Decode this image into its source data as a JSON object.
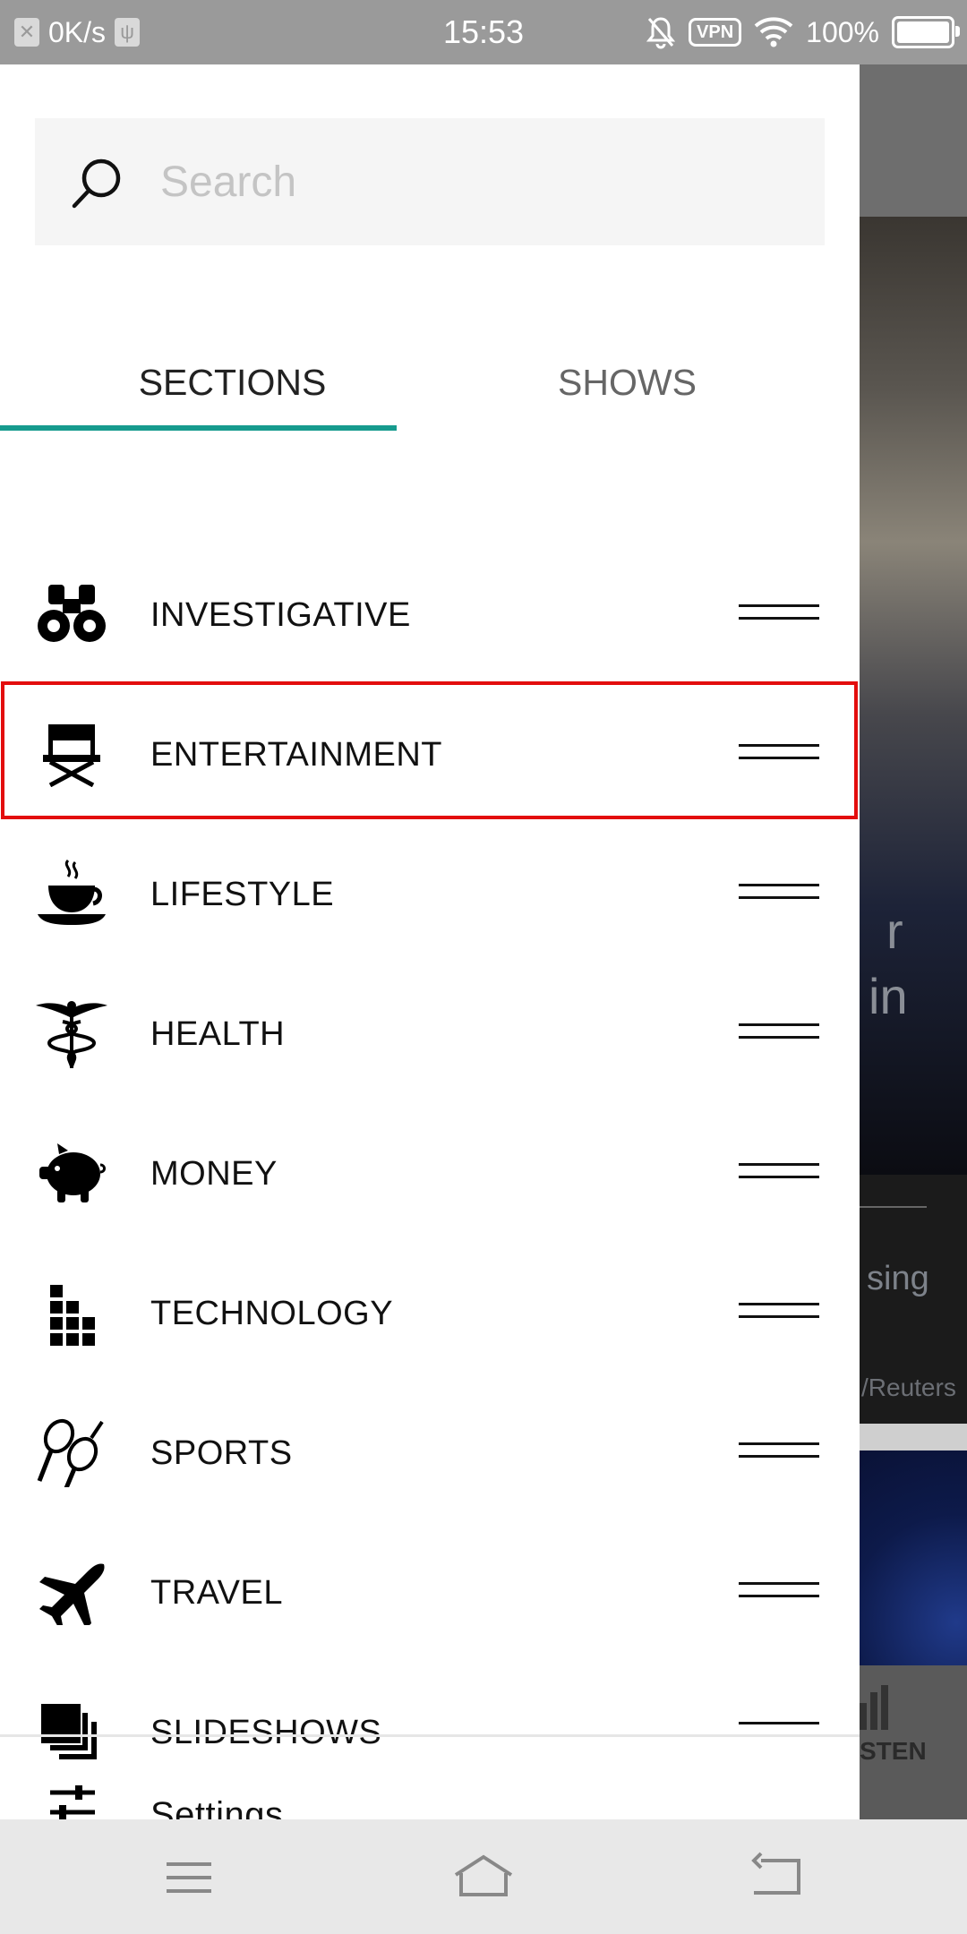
{
  "status_bar": {
    "speed": "0K/s",
    "time": "15:53",
    "vpn": "VPN",
    "battery_text": "100%",
    "battery_level": 1.0
  },
  "search": {
    "placeholder": "Search",
    "value": ""
  },
  "tabs": [
    {
      "label": "SECTIONS",
      "selected": true
    },
    {
      "label": "SHOWS",
      "selected": false
    }
  ],
  "accent_color": "#169b8e",
  "highlight_color": "#e30d0d",
  "sections": [
    {
      "label": "INVESTIGATIVE",
      "icon": "binoculars-icon"
    },
    {
      "label": "ENTERTAINMENT",
      "icon": "director-chair-icon",
      "highlighted": true
    },
    {
      "label": "LIFESTYLE",
      "icon": "coffee-cup-icon"
    },
    {
      "label": "HEALTH",
      "icon": "caduceus-icon"
    },
    {
      "label": "MONEY",
      "icon": "piggy-bank-icon"
    },
    {
      "label": "TECHNOLOGY",
      "icon": "blocks-icon"
    },
    {
      "label": "SPORTS",
      "icon": "tennis-rackets-icon"
    },
    {
      "label": "TRAVEL",
      "icon": "airplane-icon"
    },
    {
      "label": "SLIDESHOWS",
      "icon": "stacked-squares-icon"
    }
  ],
  "settings": {
    "label": "Settings",
    "icon": "sliders-icon"
  },
  "background": {
    "snippet_1": "r",
    "snippet_2": "in",
    "snippet_3": "sing",
    "snippet_4": "/Reuters",
    "nav_label": "STEN"
  },
  "nav_bar": {
    "menu": "menu-icon",
    "home": "home-icon",
    "back": "back-icon"
  }
}
